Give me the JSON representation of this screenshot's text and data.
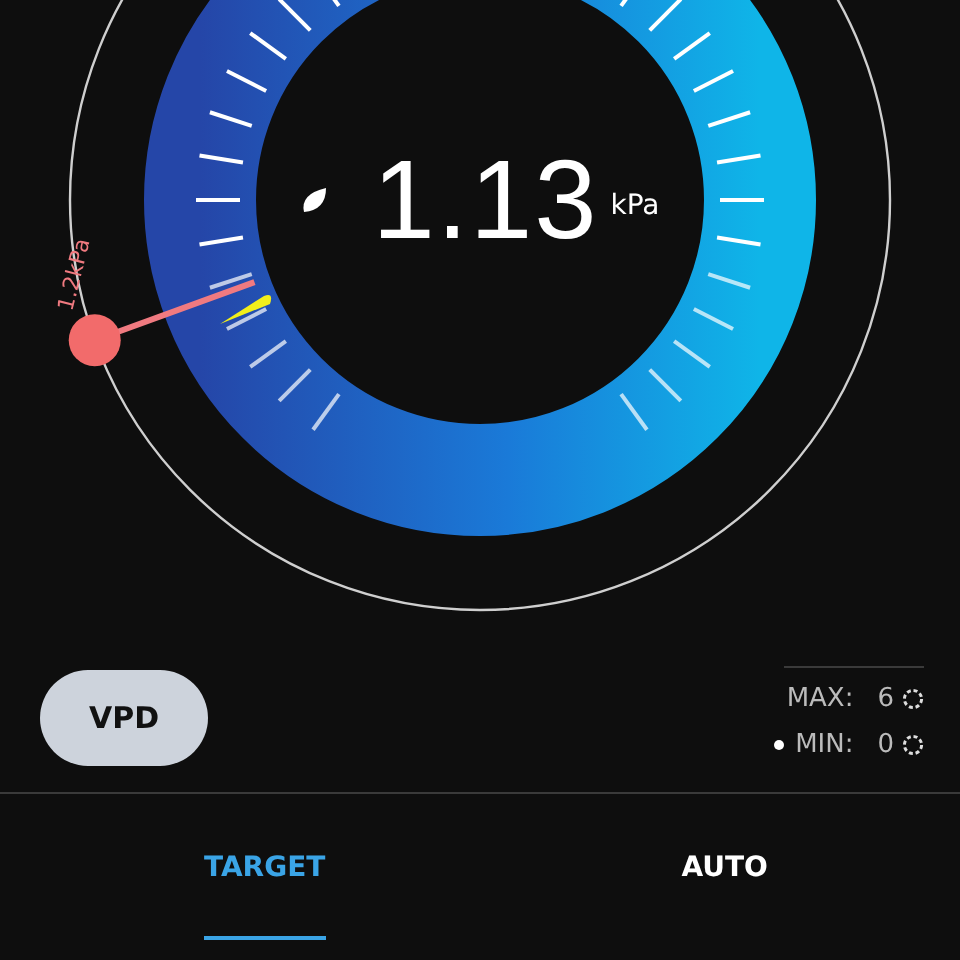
{
  "gauge": {
    "reading": "1.13",
    "unit": "kPa",
    "target_label": "1.2kPa"
  },
  "mode_button": "VPD",
  "limits": [
    {
      "label": "MAX:",
      "value": "6",
      "selected": false
    },
    {
      "label": "MIN:",
      "value": "0",
      "selected": true
    }
  ],
  "tabs": [
    {
      "label": "TARGET",
      "selected": true
    },
    {
      "label": "AUTO",
      "selected": false
    }
  ]
}
